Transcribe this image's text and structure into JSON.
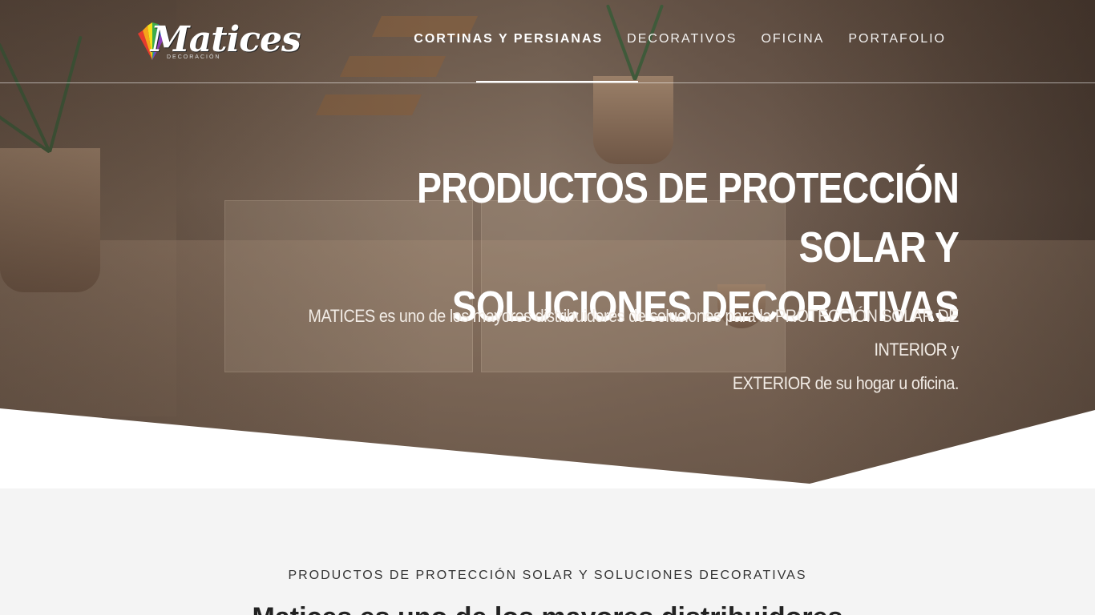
{
  "brand": {
    "logo_text": "Matices",
    "logo_tagline": "DECORACIÓN"
  },
  "nav": {
    "items": [
      {
        "label": "CORTINAS Y PERSIANAS",
        "active": true
      },
      {
        "label": "DECORATIVOS",
        "active": false
      },
      {
        "label": "OFICINA",
        "active": false
      },
      {
        "label": "PORTAFOLIO",
        "active": false
      }
    ]
  },
  "hero": {
    "title_line1": "PRODUCTOS DE PROTECCIÓN SOLAR Y",
    "title_line2": "SOLUCIONES DECORATIVAS",
    "desc_line1": "MATICES es uno de los mayores distribuidores de soluciones para la PROTECCIÓN SOLAR DE INTERIOR y",
    "desc_line2": "EXTERIOR de su hogar u oficina."
  },
  "section": {
    "eyebrow": "PRODUCTOS DE PROTECCIÓN SOLAR Y SOLUCIONES DECORATIVAS",
    "heading": "Matices es uno de los mayores distribuidores"
  },
  "colors": {
    "section_bg": "#f4f4f4",
    "hero_text": "#ffffff",
    "logo_fan": [
      "#e63b2e",
      "#f7a21b",
      "#f5e01a",
      "#3dab4a",
      "#2a7fd4",
      "#8c3fb8"
    ]
  }
}
